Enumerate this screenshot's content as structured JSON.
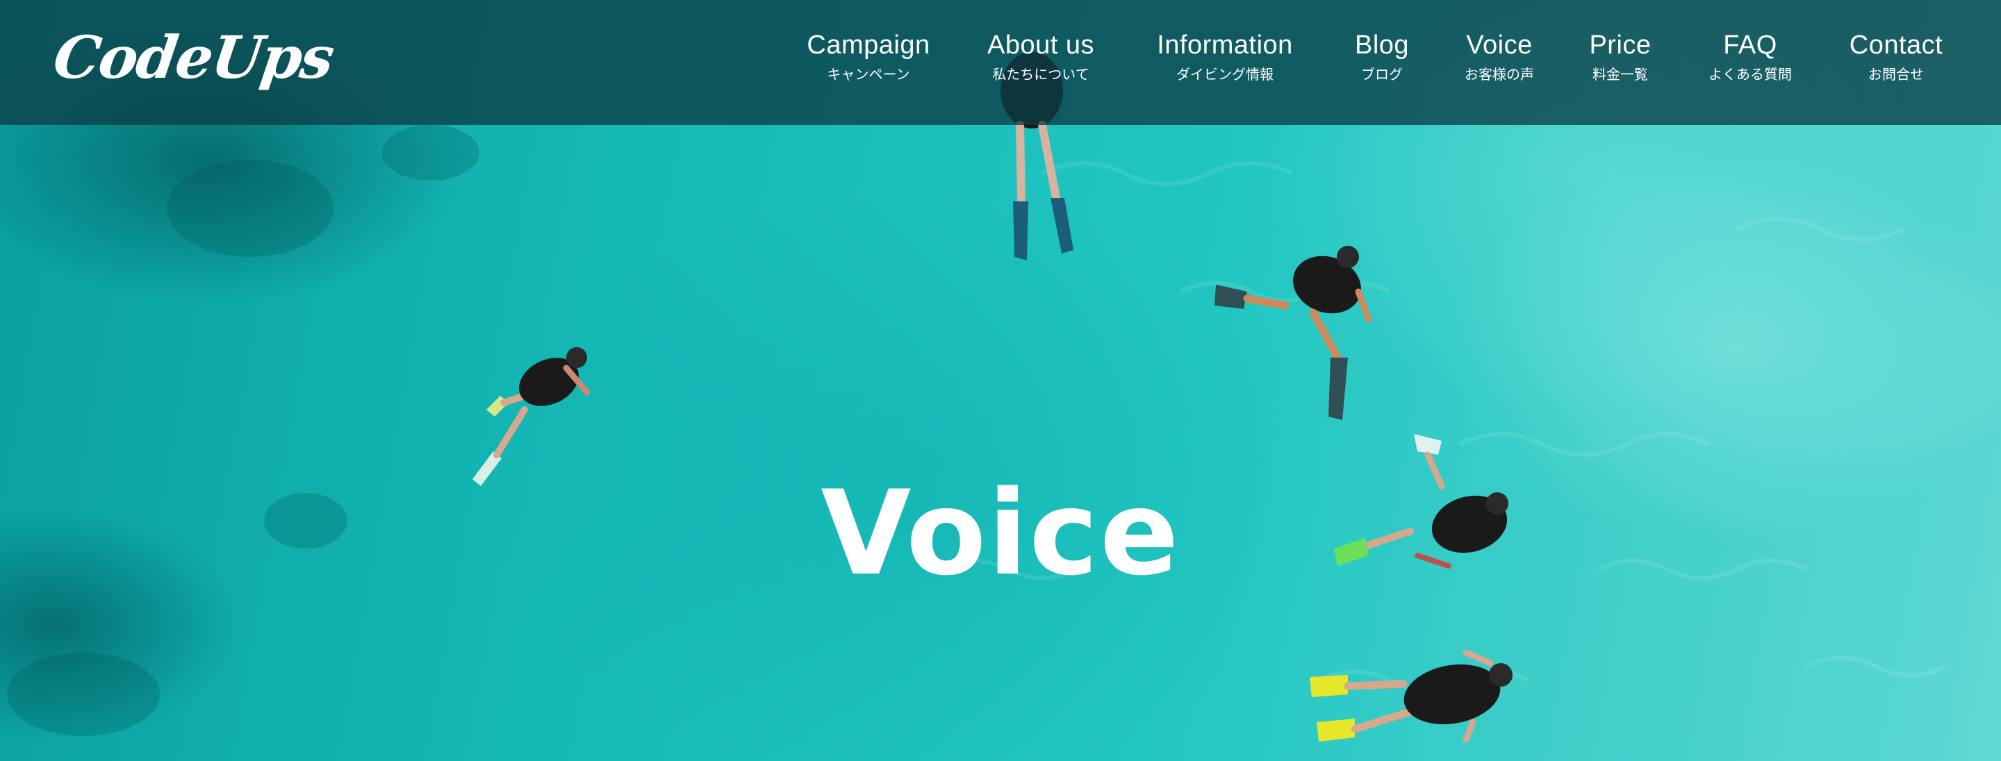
{
  "header": {
    "logo": "CodeUps",
    "nav": [
      {
        "en": "Campaign",
        "jp": "キャンペーン"
      },
      {
        "en": "About us",
        "jp": "私たちについて"
      },
      {
        "en": "Information",
        "jp": "ダイビング情報"
      },
      {
        "en": "Blog",
        "jp": "ブログ"
      },
      {
        "en": "Voice",
        "jp": "お客様の声"
      },
      {
        "en": "Price",
        "jp": "料金一覧"
      },
      {
        "en": "FAQ",
        "jp": "よくある質問"
      },
      {
        "en": "Contact",
        "jp": "お問合せ"
      }
    ]
  },
  "hero": {
    "title": "Voice",
    "image_subject": "divers-in-turquoise-sea"
  },
  "colors": {
    "header_bg": "#0c3e46",
    "sea": "#1fc3c0",
    "text": "#ffffff",
    "fin_yellow": "#e6e62a"
  }
}
